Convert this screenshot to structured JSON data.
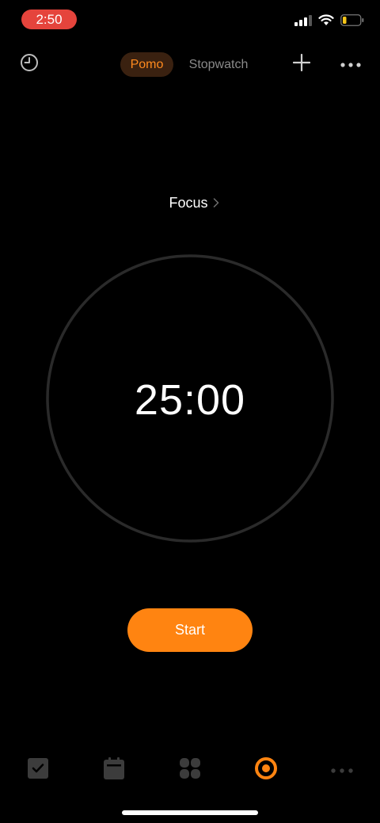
{
  "status_bar": {
    "time": "2:50",
    "time_badge_color": "#e5443c",
    "icons": [
      "cellular-signal-icon",
      "wifi-icon",
      "battery-low-icon"
    ],
    "battery_color": "#f5c518"
  },
  "header": {
    "tabs": [
      {
        "label": "Pomo",
        "active": true
      },
      {
        "label": "Stopwatch",
        "active": false
      }
    ],
    "left_icon": "history-clock-icon",
    "right_icons": [
      "plus-icon",
      "more-horizontal-icon"
    ]
  },
  "focus": {
    "label": "Focus"
  },
  "timer": {
    "display": "25:00",
    "progress": 0
  },
  "start_button": {
    "label": "Start"
  },
  "bottom_nav": {
    "items": [
      {
        "name": "tasks",
        "icon": "checkbox-icon",
        "active": false
      },
      {
        "name": "calendar",
        "icon": "calendar-icon",
        "active": false
      },
      {
        "name": "apps",
        "icon": "four-leaf-grid-icon",
        "active": false
      },
      {
        "name": "pomo",
        "icon": "pomo-target-icon",
        "active": true
      },
      {
        "name": "more",
        "icon": "more-dots-icon",
        "active": false
      }
    ]
  },
  "colors": {
    "accent": "#ff8411",
    "background": "#000000",
    "inactive_icon": "#3c3c3c"
  }
}
